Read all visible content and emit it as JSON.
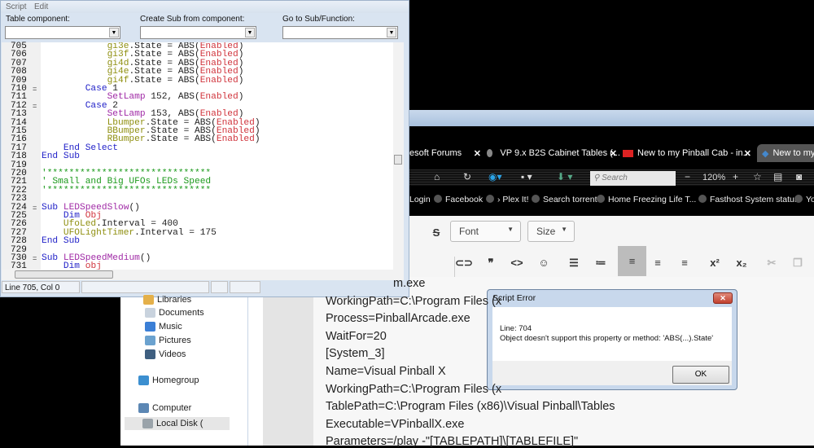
{
  "explorer": {
    "items": [
      {
        "label": "Libraries",
        "icon": "libraries-icon",
        "color": "#e4b04a"
      },
      {
        "label": "Documents",
        "icon": "documents-icon",
        "color": "#c9d3de"
      },
      {
        "label": "Music",
        "icon": "music-icon",
        "color": "#3b7fd6"
      },
      {
        "label": "Pictures",
        "icon": "pictures-icon",
        "color": "#6ba2cf"
      },
      {
        "label": "Videos",
        "icon": "videos-icon",
        "color": "#3f5f80"
      },
      {
        "label": "Homegroup",
        "icon": "homegroup-icon",
        "color": "#3c8fd0"
      },
      {
        "label": "Computer",
        "icon": "computer-icon",
        "color": "#5c87b4"
      },
      {
        "label": "Local Disk (",
        "icon": "local-disk-icon",
        "color": "#9aa3aa"
      }
    ]
  },
  "page_text": [
    "m.exe",
    "WorkingPath=C:\\Program Files (x",
    "Process=PinballArcade.exe",
    "WaitFor=20",
    "[System_3]",
    "Name=Visual Pinball X",
    "WorkingPath=C:\\Program Files (x",
    "TablePath=C:\\Program Files (x86)\\Visual Pinball\\Tables",
    "Executable=VPinballX.exe",
    "Parameters=/play -\"[TABLEPATH]\\[TABLEFILE]\""
  ],
  "browser": {
    "tabs": [
      {
        "label": "esoft Forums",
        "close": "✕"
      },
      {
        "label": "VP 9.x B2S Cabinet Tables (...",
        "close": "✕"
      },
      {
        "label": "New to my Pinball Cab - in...",
        "close": "✕"
      },
      {
        "label": "New to my",
        "close": ""
      }
    ],
    "search_placeholder": "Search",
    "zoom": "120%",
    "zoom_out": "−",
    "zoom_in": "+",
    "bookmarks": [
      "Login",
      "Facebook",
      "› Plex It!",
      "Search torrent",
      "Home  Freezing Life T...",
      "Fasthost System status",
      "Yo"
    ]
  },
  "editor_toolbar": {
    "font": "Font",
    "size": "Size",
    "strike": "S",
    "buttons": [
      {
        "name": "link-icon",
        "glyph": "⊂⊃"
      },
      {
        "name": "quote-icon",
        "glyph": "❞"
      },
      {
        "name": "code-icon",
        "glyph": "<>"
      },
      {
        "name": "emoji-icon",
        "glyph": "☺"
      },
      {
        "name": "bullet-list-icon",
        "glyph": "☰"
      },
      {
        "name": "numbered-list-icon",
        "glyph": "≔"
      },
      {
        "name": "align-left-icon",
        "glyph": "≡"
      },
      {
        "name": "align-center-icon",
        "glyph": "≡"
      },
      {
        "name": "align-right-icon",
        "glyph": "≡"
      },
      {
        "name": "superscript-icon",
        "glyph": "x²"
      },
      {
        "name": "subscript-icon",
        "glyph": "x₂"
      },
      {
        "name": "cut-icon",
        "glyph": "✂"
      },
      {
        "name": "copy-icon",
        "glyph": "❐"
      }
    ]
  },
  "script_window": {
    "menu": [
      "Script",
      "Edit"
    ],
    "labels": {
      "table_component": "Table component:",
      "create_sub": "Create Sub from component:",
      "goto_sub": "Go to Sub/Function:"
    },
    "code": [
      {
        "n": "705",
        "fold": "",
        "t": [
          [
            "pl",
            "            "
          ],
          [
            "obj",
            "gi3e"
          ],
          [
            "pl",
            ".State = ABS("
          ],
          [
            "var",
            "Enabled"
          ],
          [
            "pl",
            ")"
          ]
        ]
      },
      {
        "n": "706",
        "fold": "",
        "t": [
          [
            "pl",
            "            "
          ],
          [
            "obj",
            "gi3f"
          ],
          [
            "pl",
            ".State = ABS("
          ],
          [
            "var",
            "Enabled"
          ],
          [
            "pl",
            ")"
          ]
        ]
      },
      {
        "n": "707",
        "fold": "",
        "t": [
          [
            "pl",
            "            "
          ],
          [
            "obj",
            "gi4d"
          ],
          [
            "pl",
            ".State = ABS("
          ],
          [
            "var",
            "Enabled"
          ],
          [
            "pl",
            ")"
          ]
        ]
      },
      {
        "n": "708",
        "fold": "",
        "t": [
          [
            "pl",
            "            "
          ],
          [
            "obj",
            "gi4e"
          ],
          [
            "pl",
            ".State = ABS("
          ],
          [
            "var",
            "Enabled"
          ],
          [
            "pl",
            ")"
          ]
        ]
      },
      {
        "n": "709",
        "fold": "",
        "t": [
          [
            "pl",
            "            "
          ],
          [
            "obj",
            "gi4f"
          ],
          [
            "pl",
            ".State = ABS("
          ],
          [
            "var",
            "Enabled"
          ],
          [
            "pl",
            ")"
          ]
        ]
      },
      {
        "n": "710",
        "fold": "=",
        "t": [
          [
            "pl",
            "        "
          ],
          [
            "kw",
            "Case"
          ],
          [
            "pl",
            " 1"
          ]
        ]
      },
      {
        "n": "711",
        "fold": "",
        "t": [
          [
            "pl",
            "            "
          ],
          [
            "fn",
            "SetLamp"
          ],
          [
            "pl",
            " 152, ABS("
          ],
          [
            "var",
            "Enabled"
          ],
          [
            "pl",
            ")"
          ]
        ]
      },
      {
        "n": "712",
        "fold": "=",
        "t": [
          [
            "pl",
            "        "
          ],
          [
            "kw",
            "Case"
          ],
          [
            "pl",
            " 2"
          ]
        ]
      },
      {
        "n": "713",
        "fold": "",
        "t": [
          [
            "pl",
            "            "
          ],
          [
            "fn",
            "SetLamp"
          ],
          [
            "pl",
            " 153, ABS("
          ],
          [
            "var",
            "Enabled"
          ],
          [
            "pl",
            ")"
          ]
        ]
      },
      {
        "n": "714",
        "fold": "",
        "t": [
          [
            "pl",
            "            "
          ],
          [
            "obj",
            "Lbumper"
          ],
          [
            "pl",
            ".State = ABS("
          ],
          [
            "var",
            "Enabled"
          ],
          [
            "pl",
            ")"
          ]
        ]
      },
      {
        "n": "715",
        "fold": "",
        "t": [
          [
            "pl",
            "            "
          ],
          [
            "obj",
            "BBumper"
          ],
          [
            "pl",
            ".State = ABS("
          ],
          [
            "var",
            "Enabled"
          ],
          [
            "pl",
            ")"
          ]
        ]
      },
      {
        "n": "716",
        "fold": "",
        "t": [
          [
            "pl",
            "            "
          ],
          [
            "obj",
            "RBumper"
          ],
          [
            "pl",
            ".State = ABS("
          ],
          [
            "var",
            "Enabled"
          ],
          [
            "pl",
            ")"
          ]
        ]
      },
      {
        "n": "717",
        "fold": "",
        "t": [
          [
            "pl",
            "    "
          ],
          [
            "kw",
            "End Select"
          ]
        ]
      },
      {
        "n": "718",
        "fold": "",
        "t": [
          [
            "kw",
            "End Sub"
          ]
        ]
      },
      {
        "n": "719",
        "fold": "",
        "t": []
      },
      {
        "n": "720",
        "fold": "",
        "t": [
          [
            "cm",
            "'******************************"
          ]
        ]
      },
      {
        "n": "721",
        "fold": "",
        "t": [
          [
            "cm",
            "' Small and Big UFOs LEDs Speed"
          ]
        ]
      },
      {
        "n": "722",
        "fold": "",
        "t": [
          [
            "cm",
            "'******************************"
          ]
        ]
      },
      {
        "n": "723",
        "fold": "",
        "t": []
      },
      {
        "n": "724",
        "fold": "=",
        "t": [
          [
            "kw",
            "Sub"
          ],
          [
            "pl",
            " "
          ],
          [
            "fn",
            "LEDSpeedSlow"
          ],
          [
            "pl",
            "()"
          ]
        ]
      },
      {
        "n": "725",
        "fold": "",
        "t": [
          [
            "pl",
            "    "
          ],
          [
            "kw",
            "Dim"
          ],
          [
            "pl",
            " "
          ],
          [
            "var",
            "Obj"
          ]
        ]
      },
      {
        "n": "726",
        "fold": "",
        "t": [
          [
            "pl",
            "    "
          ],
          [
            "obj",
            "UfoLed"
          ],
          [
            "pl",
            ".Interval = 400"
          ]
        ]
      },
      {
        "n": "727",
        "fold": "",
        "t": [
          [
            "pl",
            "    "
          ],
          [
            "obj",
            "UFOLightTimer"
          ],
          [
            "pl",
            ".Interval = 175"
          ]
        ]
      },
      {
        "n": "728",
        "fold": "",
        "t": [
          [
            "kw",
            "End Sub"
          ]
        ]
      },
      {
        "n": "729",
        "fold": "",
        "t": []
      },
      {
        "n": "730",
        "fold": "=",
        "t": [
          [
            "kw",
            "Sub"
          ],
          [
            "pl",
            " "
          ],
          [
            "fn",
            "LEDSpeedMedium"
          ],
          [
            "pl",
            "()"
          ]
        ]
      },
      {
        "n": "731",
        "fold": "",
        "t": [
          [
            "pl",
            "    "
          ],
          [
            "kw",
            "Dim"
          ],
          [
            "pl",
            " "
          ],
          [
            "var",
            "obj"
          ]
        ]
      }
    ],
    "status": "Line 705, Col 0"
  },
  "dialog": {
    "title": "Script Error",
    "close": "✕",
    "line": "Line: 704",
    "message": "Object doesn't support this property or method: 'ABS(...).State'",
    "ok": "OK"
  }
}
